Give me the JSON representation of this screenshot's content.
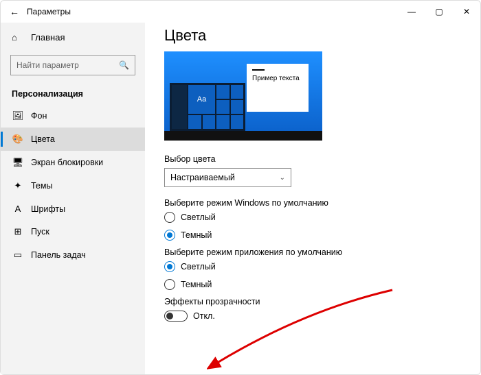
{
  "window": {
    "title": "Параметры"
  },
  "sidebar": {
    "home": "Главная",
    "searchPlaceholder": "Найти параметр",
    "category": "Персонализация",
    "items": [
      {
        "icon": "🖼",
        "label": "Фон"
      },
      {
        "icon": "🎨",
        "label": "Цвета"
      },
      {
        "icon": "🖥",
        "label": "Экран блокировки"
      },
      {
        "icon": "✦",
        "label": "Темы"
      },
      {
        "icon": "A",
        "label": "Шрифты"
      },
      {
        "icon": "⊞",
        "label": "Пуск"
      },
      {
        "icon": "▭",
        "label": "Панель задач"
      }
    ]
  },
  "main": {
    "title": "Цвета",
    "preview": {
      "tileText": "Aa",
      "cardText": "Пример текста"
    },
    "colorPick": {
      "label": "Выбор цвета",
      "value": "Настраиваемый"
    },
    "windowsMode": {
      "label": "Выберите режим Windows по умолчанию",
      "options": [
        "Светлый",
        "Темный"
      ],
      "selected": "Темный"
    },
    "appMode": {
      "label": "Выберите режим приложения по умолчанию",
      "options": [
        "Светлый",
        "Темный"
      ],
      "selected": "Светлый"
    },
    "transparency": {
      "label": "Эффекты прозрачности",
      "state": "Откл."
    }
  }
}
